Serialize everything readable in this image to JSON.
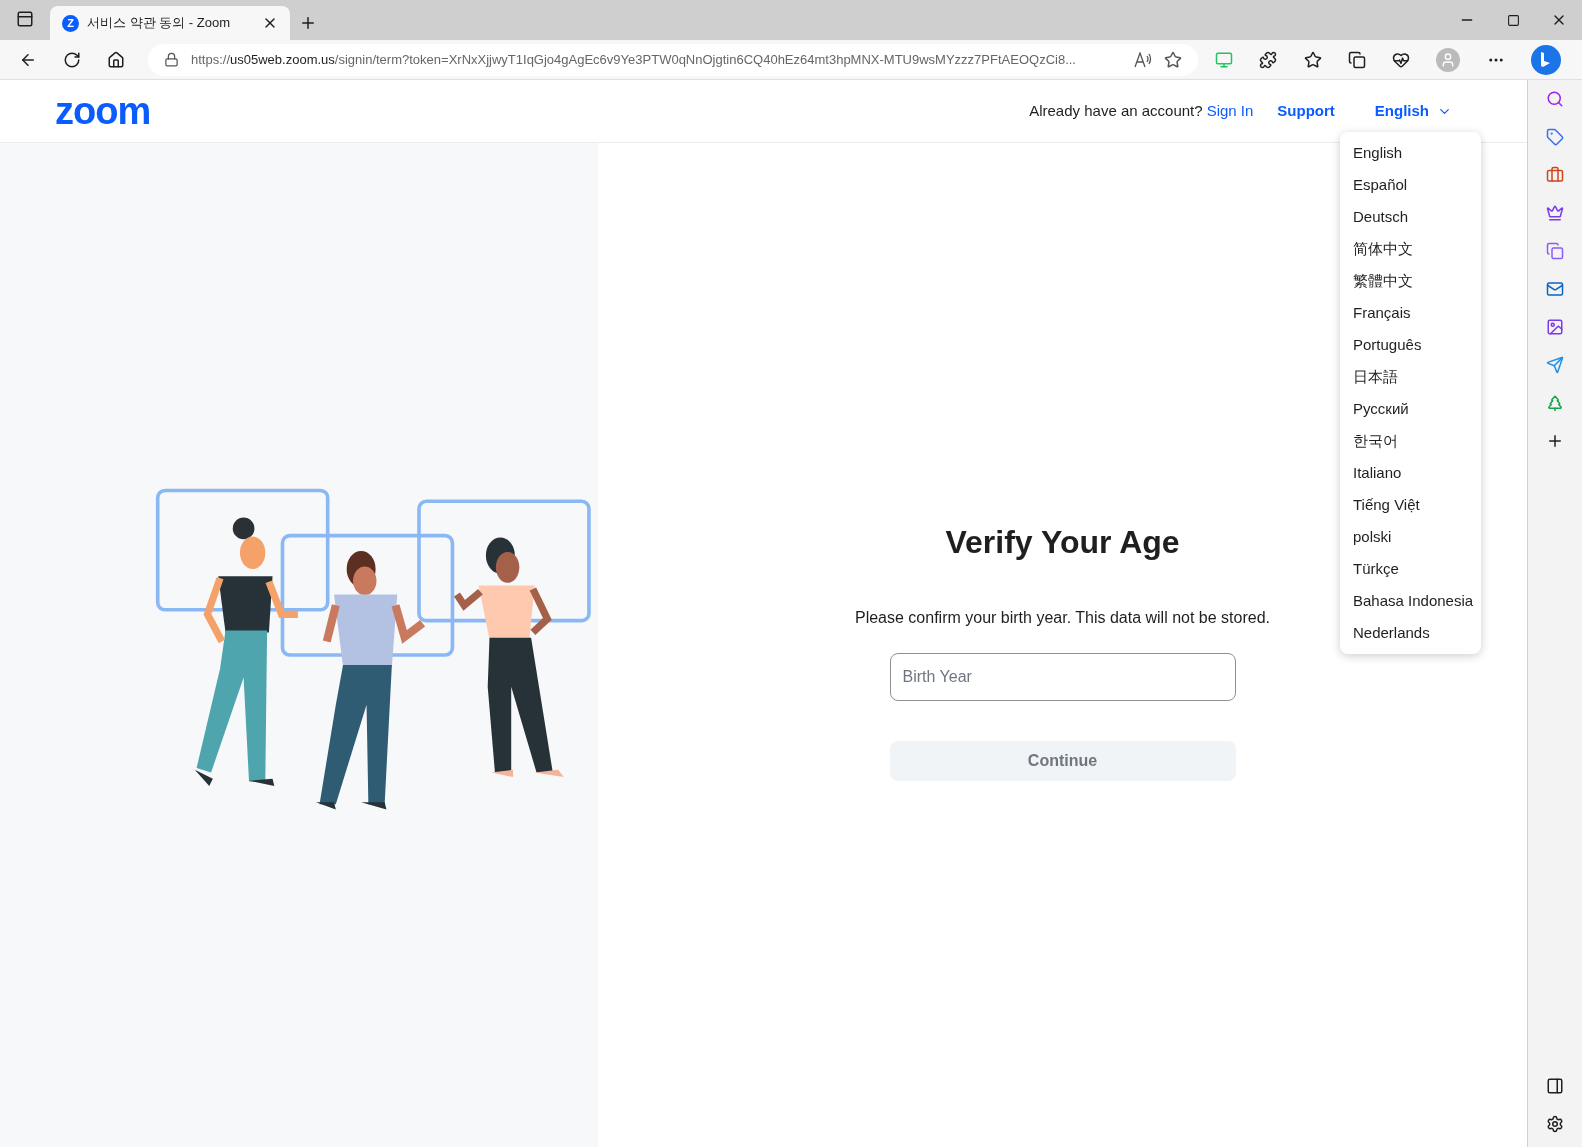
{
  "browser": {
    "tab_title": "서비스 약관 동의 - Zoom",
    "tab_icon_letter": "Z",
    "url": {
      "scheme": "https://",
      "host": "us05web.zoom.us",
      "rest": "/signin/term?token=XrNxXjjwyT1IqGjo4gAgEc6v9Ye3PTW0qNnOjgtin6CQ40hEz64mt3hpMNX-MTU9wsMYzzz7PFtAEOQzCi8..."
    }
  },
  "header": {
    "logo": "zoom",
    "account_prompt": "Already have an account?",
    "sign_in": "Sign In",
    "support": "Support",
    "language": "English"
  },
  "language_menu": {
    "expanded": true,
    "items": [
      {
        "label": "English"
      },
      {
        "label": "Español"
      },
      {
        "label": "Deutsch"
      },
      {
        "label": "简体中文"
      },
      {
        "label": "繁體中文"
      },
      {
        "label": "Français"
      },
      {
        "label": "Português"
      },
      {
        "label": "日本語"
      },
      {
        "label": "Русский"
      },
      {
        "label": "한국어"
      },
      {
        "label": "Italiano"
      },
      {
        "label": "Tiếng Việt"
      },
      {
        "label": "polski"
      },
      {
        "label": "Türkçe"
      },
      {
        "label": "Bahasa Indonesia"
      },
      {
        "label": "Nederlands"
      }
    ]
  },
  "form": {
    "title": "Verify Your Age",
    "description": "Please confirm your birth year. This data will not be stored.",
    "birth_year": {
      "placeholder": "Birth Year"
    },
    "continue": {
      "label": "Continue",
      "disabled": true
    }
  }
}
